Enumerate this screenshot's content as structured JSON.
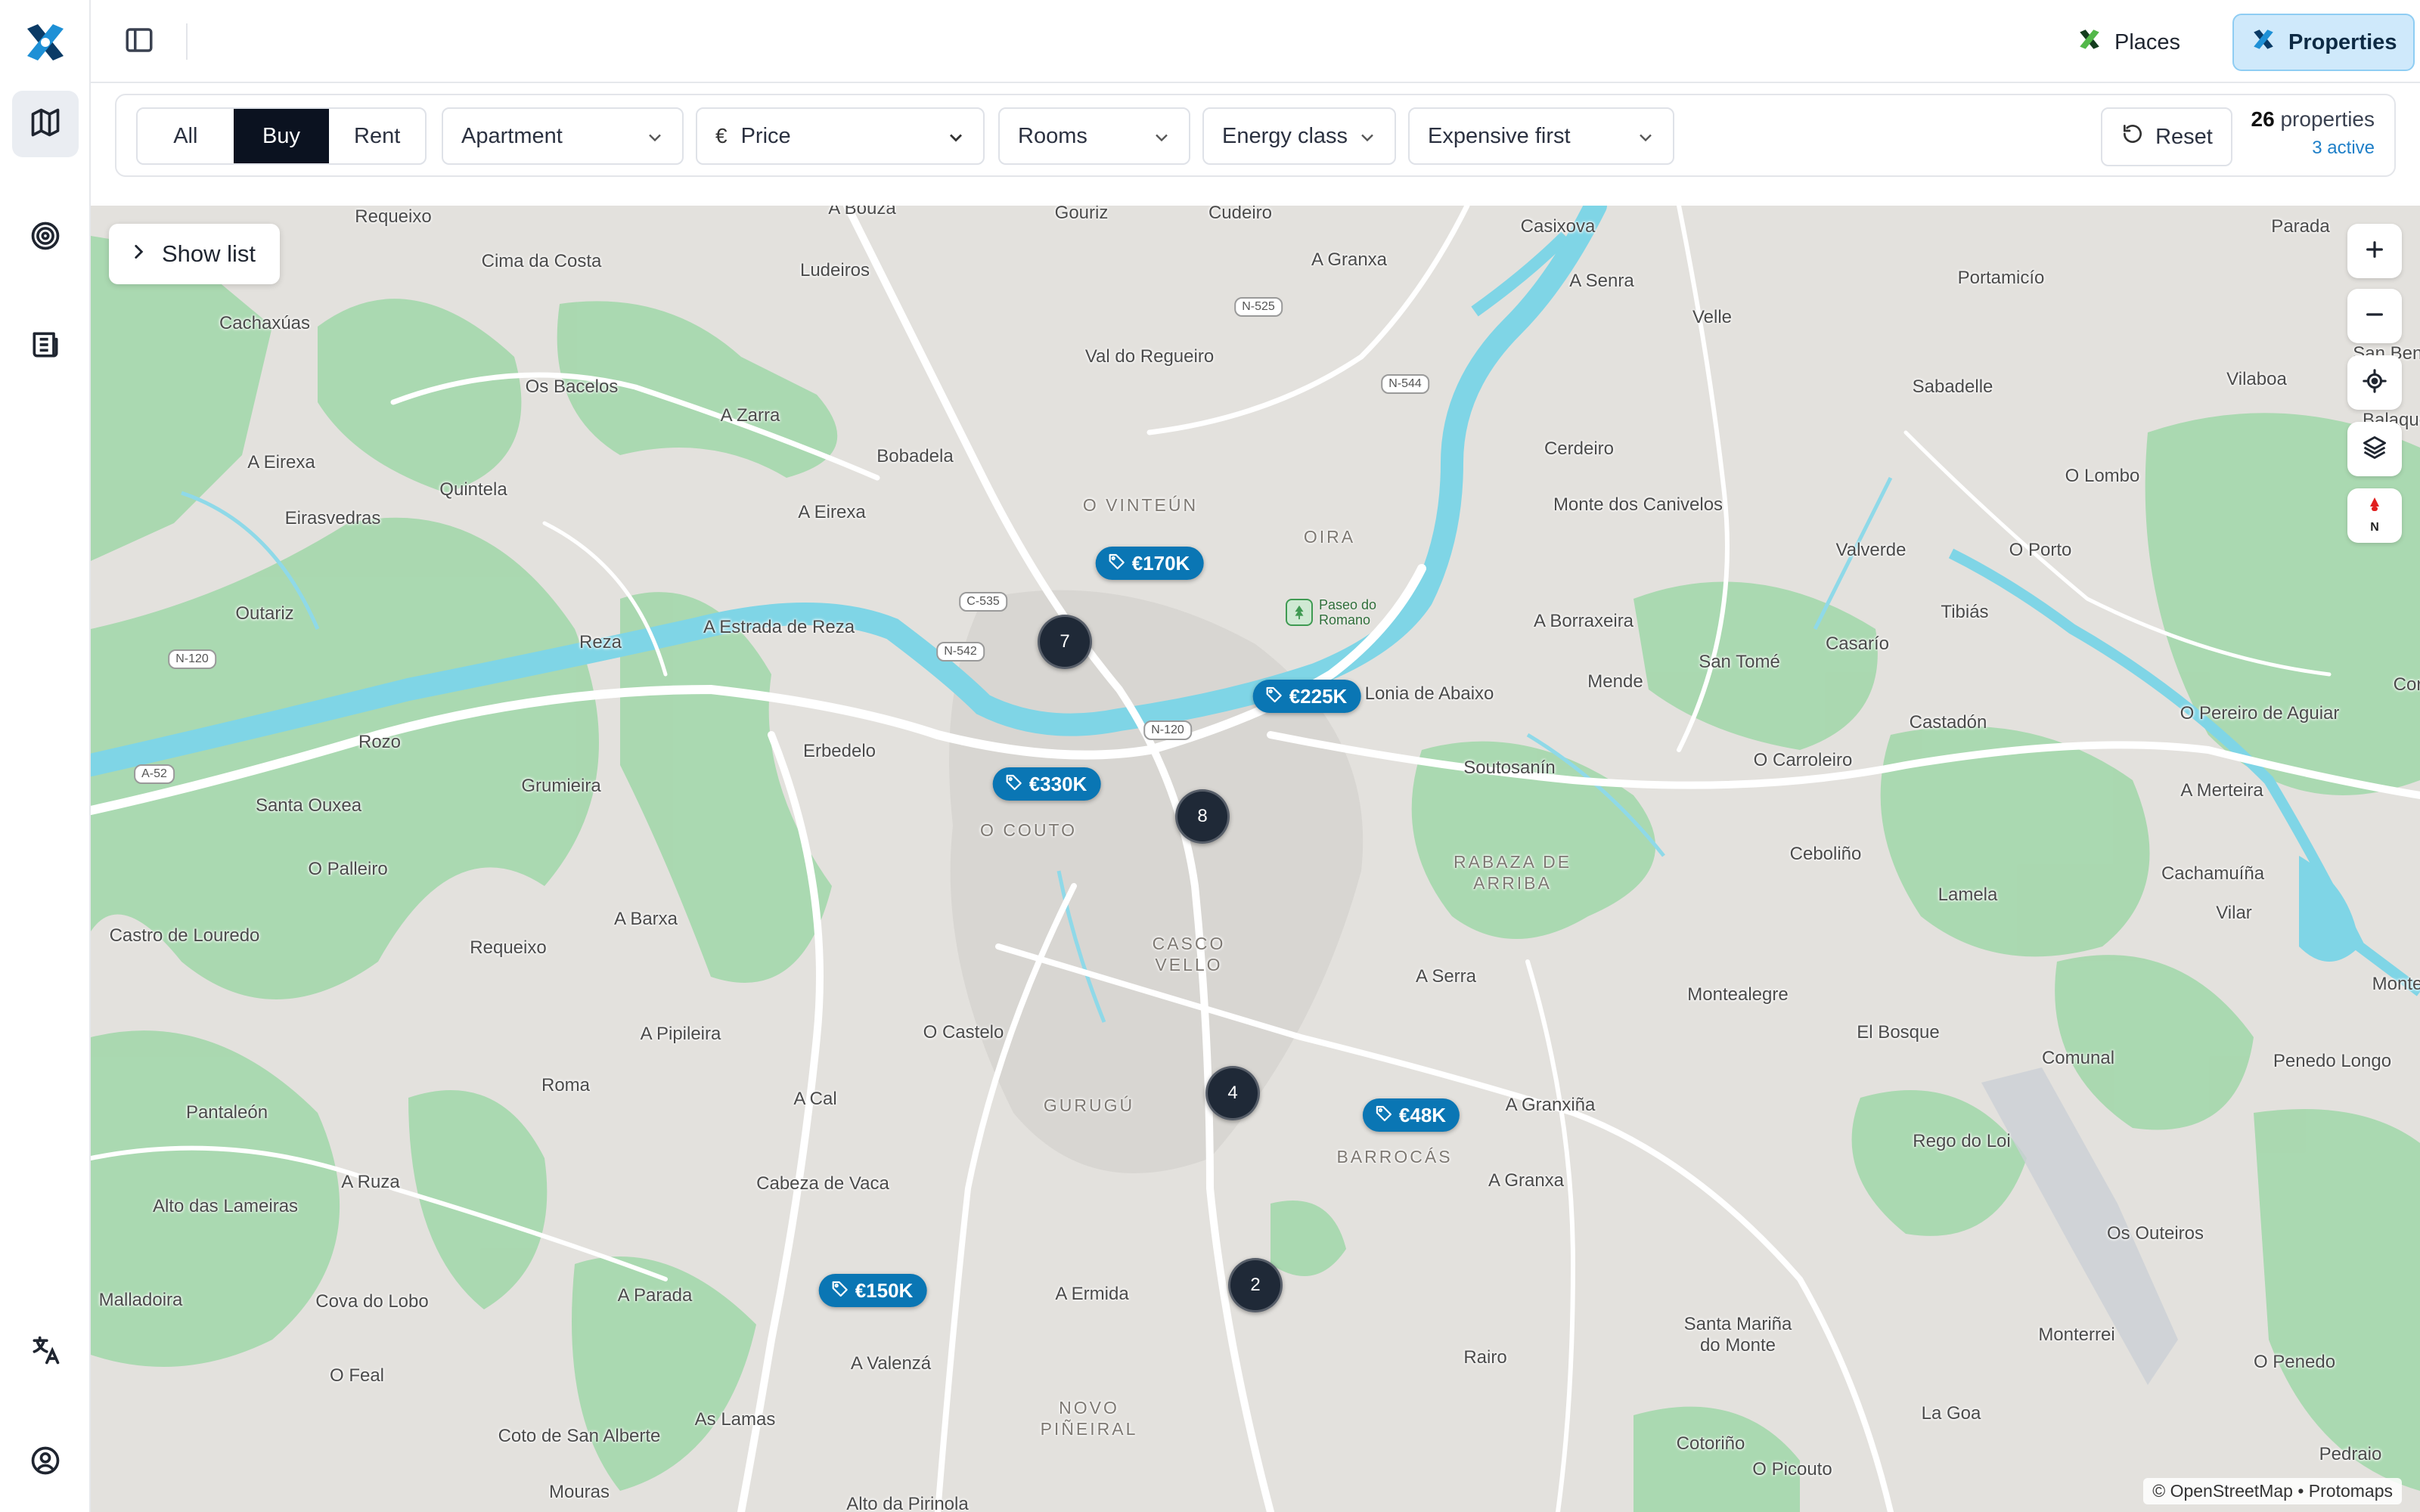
{
  "nav": {
    "items": [
      {
        "icon": "map-icon",
        "active": true
      },
      {
        "icon": "target-icon",
        "active": false
      },
      {
        "icon": "newspaper-icon",
        "active": false
      }
    ],
    "bottom": [
      {
        "icon": "translate-icon"
      },
      {
        "icon": "user-circle-icon"
      }
    ]
  },
  "topbar": {
    "places_label": "Places",
    "properties_label": "Properties",
    "active_tab": "Properties"
  },
  "filters": {
    "listing_type": {
      "options": [
        "All",
        "Buy",
        "Rent"
      ],
      "selected": "Buy"
    },
    "property_type": "Apartment",
    "price": {
      "icon": "€",
      "label": "Price"
    },
    "rooms": "Rooms",
    "energy_class": "Energy class",
    "sort": "Expensive first",
    "reset_label": "Reset",
    "count": "26",
    "count_suffix": "properties",
    "active_label": "3 active"
  },
  "map": {
    "show_list_label": "Show list",
    "attribution": "© OpenStreetMap • Protomaps",
    "compass_label": "N",
    "colors": {
      "land": "#e3e1dd",
      "water": "#7fd5e6",
      "green": "#9fd4a8",
      "road": "#ffffff",
      "pin": "#0a76b4",
      "cluster": "#1f2937"
    },
    "price_pins": [
      "€170K",
      "€225K",
      "€330K",
      "€48K",
      "€150K"
    ],
    "clusters": [
      "7",
      "8",
      "4",
      "2"
    ],
    "poi": "Paseo do\nRomano",
    "places": [
      "Requeixo",
      "A Bouza",
      "Gouriz",
      "Cudeiro",
      "Casixova",
      "Parada",
      "Cima da Costa",
      "Ludeiros",
      "A Granxa",
      "A Senra",
      "Portamicío",
      "Cachaxúas",
      "Val do Regueiro",
      "Velle",
      "San Benito",
      "Os Bacelos",
      "A Zarra",
      "Sabadelle",
      "Vilaboa",
      "Balaque",
      "Bobadela",
      "Cerdeiro",
      "A Eirexa",
      "Quintela",
      "O Lombo",
      "A Eirexa",
      "Monte dos Canivelos",
      "Eirasvedras",
      "Valverde",
      "O Porto",
      "Outariz",
      "Reza",
      "A Estrada de Reza",
      "A Borraxeira",
      "Tibiás",
      "Casarío",
      "Lonia de Abaixo",
      "Mende",
      "San Tomé",
      "Cor",
      "Castadón",
      "O Pereiro de Aguiar",
      "Rozo",
      "Erbedelo",
      "O Carroleiro",
      "Soutosanín",
      "Santa Ouxea",
      "Grumieira",
      "A Merteira",
      "Ceboliño",
      "Cachamuíña",
      "O Palleiro",
      "A Barxa",
      "Lamela",
      "Vilar",
      "Castro de Louredo",
      "Requeixo",
      "A Serra",
      "Monte d",
      "Montealegre",
      "A Pipileira",
      "O Castelo",
      "El Bosque",
      "Penedo Longo",
      "Roma",
      "Comunal",
      "Pantaleón",
      "A Cal",
      "A Granxiña",
      "Rego do Loi",
      "A Ruza",
      "Cabeza de Vaca",
      "A Granxa",
      "Alto das Lameiras",
      "Os Outeiros",
      "Malladoira",
      "Cova do Lobo",
      "A Parada",
      "A Ermida",
      "Santa Mariña\ndo Monte",
      "Monterrei",
      "O Feal",
      "A Valenzá",
      "Rairo",
      "O Penedo",
      "As Lamas",
      "La Goa",
      "Coto de San Alberte",
      "Cotoriño",
      "O Picouto",
      "Pedraio",
      "Mouras",
      "Alto da Pirinola"
    ],
    "districts": [
      "O VINTEÚN",
      "OIRA",
      "O COUTO",
      "RABAZA DE\nARRIBA",
      "CASCO\nVELLO",
      "GURUGÚ",
      "BARROCÁS",
      "NOVO\nPIÑEIRAL"
    ],
    "roads": [
      "N-525",
      "N-544",
      "C-535",
      "N-542",
      "N-120",
      "N-120",
      "A-52"
    ]
  }
}
